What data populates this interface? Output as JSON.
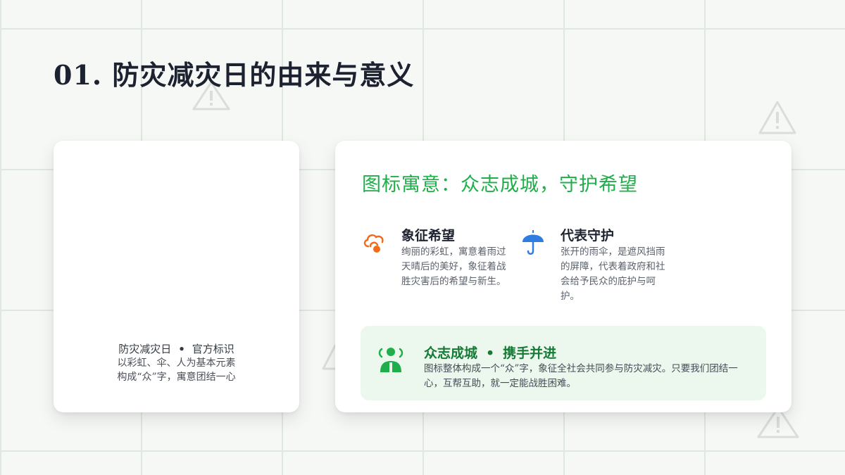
{
  "page": {
    "title": "01. 防灾减灾日的由来与意义"
  },
  "left_card": {
    "caption_title": "防灾减灾日",
    "caption_separator": "•",
    "caption_title_2": "官方标识",
    "caption_line_2": "以彩虹、伞、人为基本元素",
    "caption_line_3": "构成“众”字，寓意团结一心"
  },
  "right_card": {
    "heading": "图标寓意：众志成城，守护希望",
    "features": [
      {
        "icon": "rainbow-cloud-icon",
        "title": "象征希望",
        "description": "绚丽的彩虹，寓意着雨过天晴后的美好，象征着战胜灾害后的希望与新生。"
      },
      {
        "icon": "umbrella-icon",
        "title": "代表守护",
        "description": "张开的雨伞，是遮风挡雨的屏障，代表着政府和社会给予民众的庇护与呵护。"
      }
    ],
    "banner": {
      "icon": "group-people-icon",
      "title_a": "众志成城",
      "separator": "•",
      "title_b": "携手并进",
      "description": "图标整体构成一个“众”字，象征全社会共同参与防灾减灾。只要我们团结一心，互帮互助，就一定能战胜困难。"
    }
  },
  "colors": {
    "accent_green": "#1fae4a",
    "dark_green": "#167a36",
    "banner_bg": "#ecf8ee",
    "orange": "#f26b1d",
    "blue": "#2f7de1",
    "grid_line": "#dfe8e0"
  }
}
